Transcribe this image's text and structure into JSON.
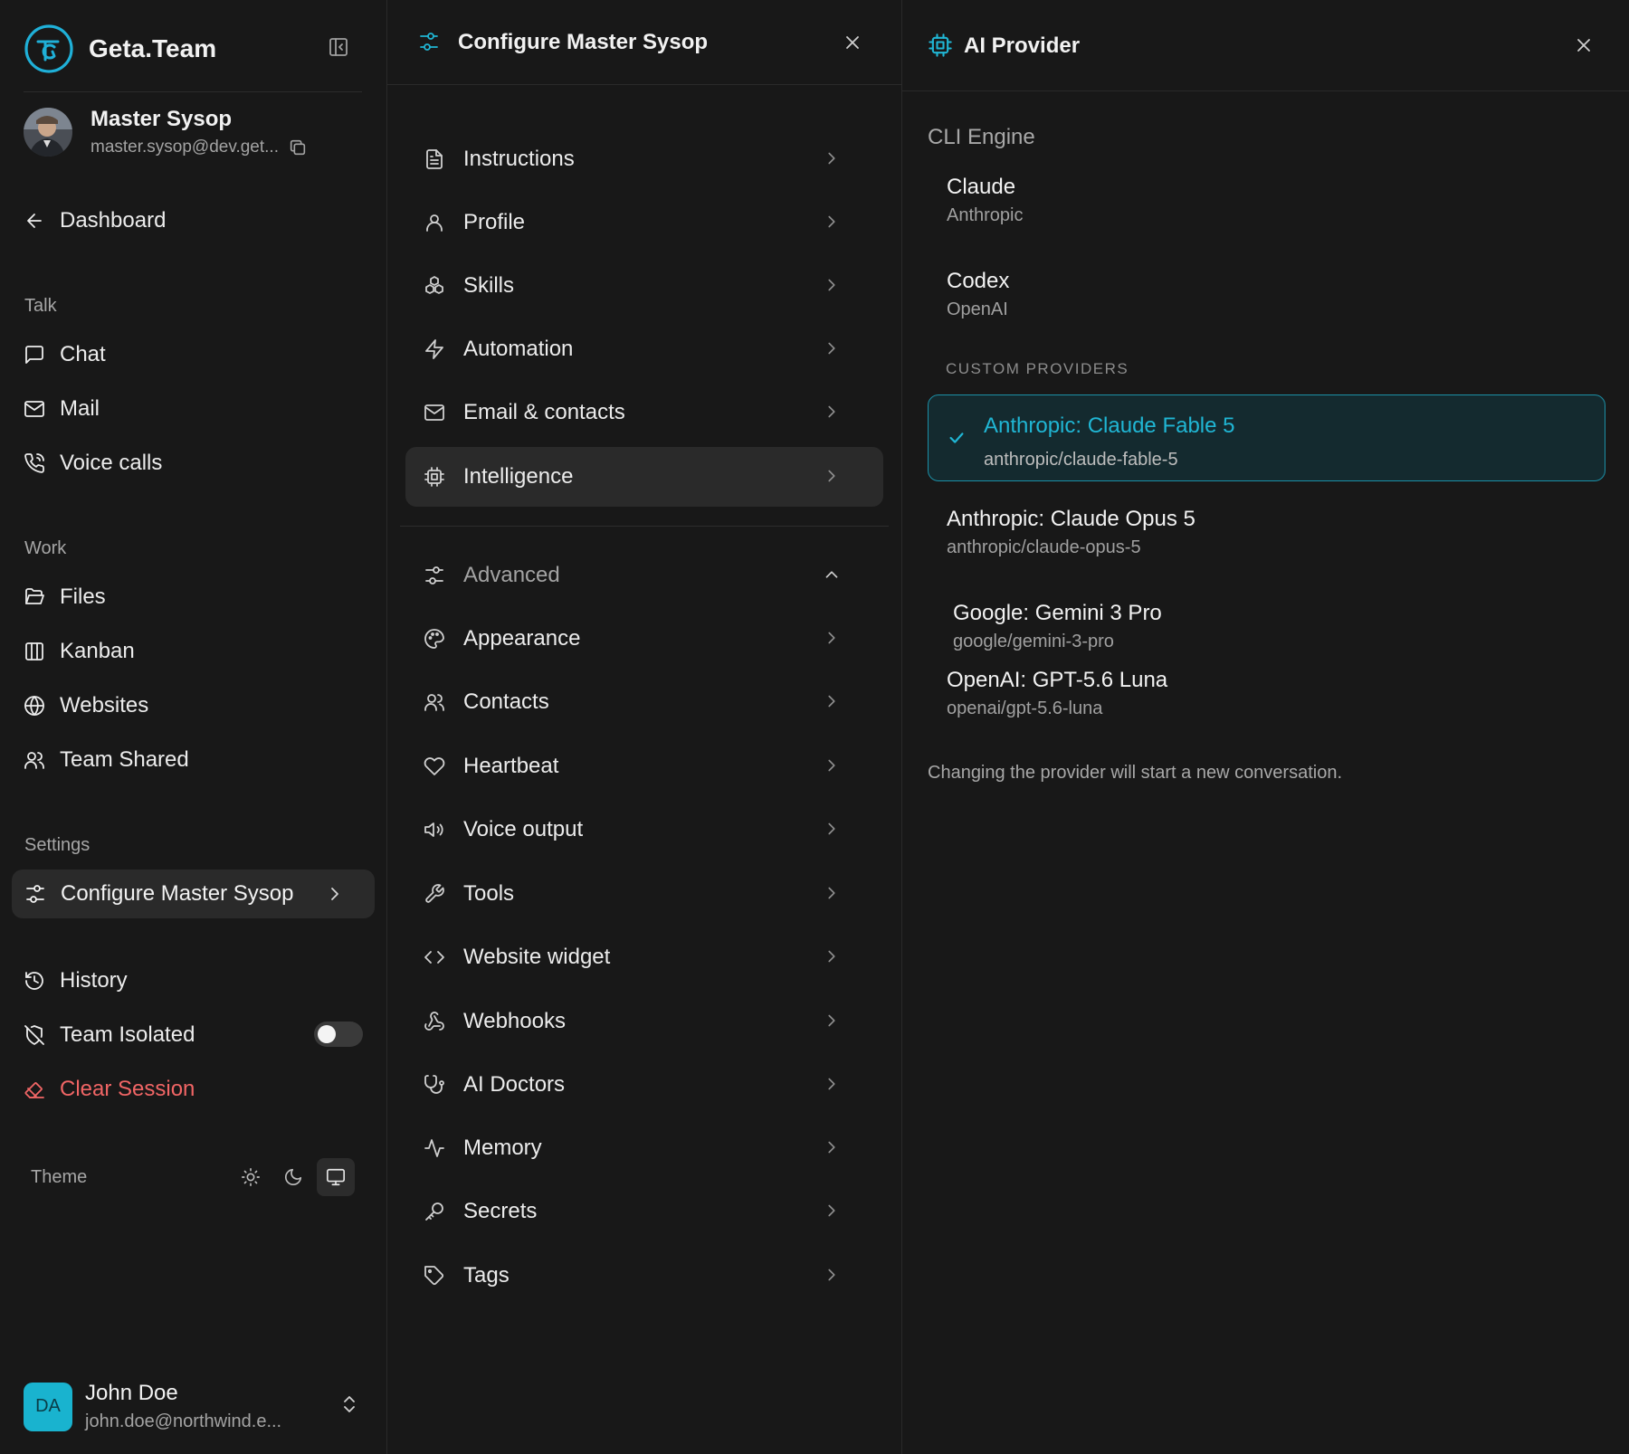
{
  "sidebar": {
    "brand_name": "Geta.Team",
    "profile": {
      "name": "Master Sysop",
      "email": "master.sysop@dev.get..."
    },
    "dashboard_label": "Dashboard",
    "sections": {
      "talk": "Talk",
      "work": "Work",
      "settings": "Settings"
    },
    "talk_items": [
      "Chat",
      "Mail",
      "Voice calls"
    ],
    "work_items": [
      "Files",
      "Kanban",
      "Websites",
      "Team Shared"
    ],
    "configure_label": "Configure Master Sysop",
    "history_label": "History",
    "team_isolated_label": "Team Isolated",
    "team_isolated_on": false,
    "clear_session_label": "Clear Session",
    "theme_label": "Theme",
    "theme_selected": "system",
    "user": {
      "initials": "DA",
      "name": "John Doe",
      "email": "john.doe@northwind.e..."
    }
  },
  "config": {
    "title": "Configure Master Sysop",
    "items": [
      "Instructions",
      "Profile",
      "Skills",
      "Automation",
      "Email & contacts",
      "Intelligence"
    ],
    "active_item": "Intelligence",
    "advanced_label": "Advanced",
    "advanced_items": [
      "Appearance",
      "Contacts",
      "Heartbeat",
      "Voice output",
      "Tools",
      "Website widget",
      "Webhooks",
      "AI Doctors",
      "Memory",
      "Secrets",
      "Tags"
    ]
  },
  "provider": {
    "title": "AI Provider",
    "cli_label": "CLI Engine",
    "cli_options": [
      {
        "name": "Claude",
        "vendor": "Anthropic"
      },
      {
        "name": "Codex",
        "vendor": "OpenAI"
      }
    ],
    "custom_label": "CUSTOM PROVIDERS",
    "custom_options": [
      {
        "name": "Anthropic: Claude Fable 5",
        "id": "anthropic/claude-fable-5",
        "selected": true
      },
      {
        "name": "Anthropic: Claude Opus 5",
        "id": "anthropic/claude-opus-5"
      },
      {
        "name": "Google: Gemini 3 Pro",
        "id": "google/gemini-3-pro"
      },
      {
        "name": "OpenAI: GPT-5.6 Luna",
        "id": "openai/gpt-5.6-luna"
      }
    ],
    "note": "Changing the provider will start a new conversation."
  },
  "colors": {
    "accent": "#20b6d4",
    "danger": "#f06565",
    "background": "#181818",
    "active_bg": "#2a2a2a"
  }
}
